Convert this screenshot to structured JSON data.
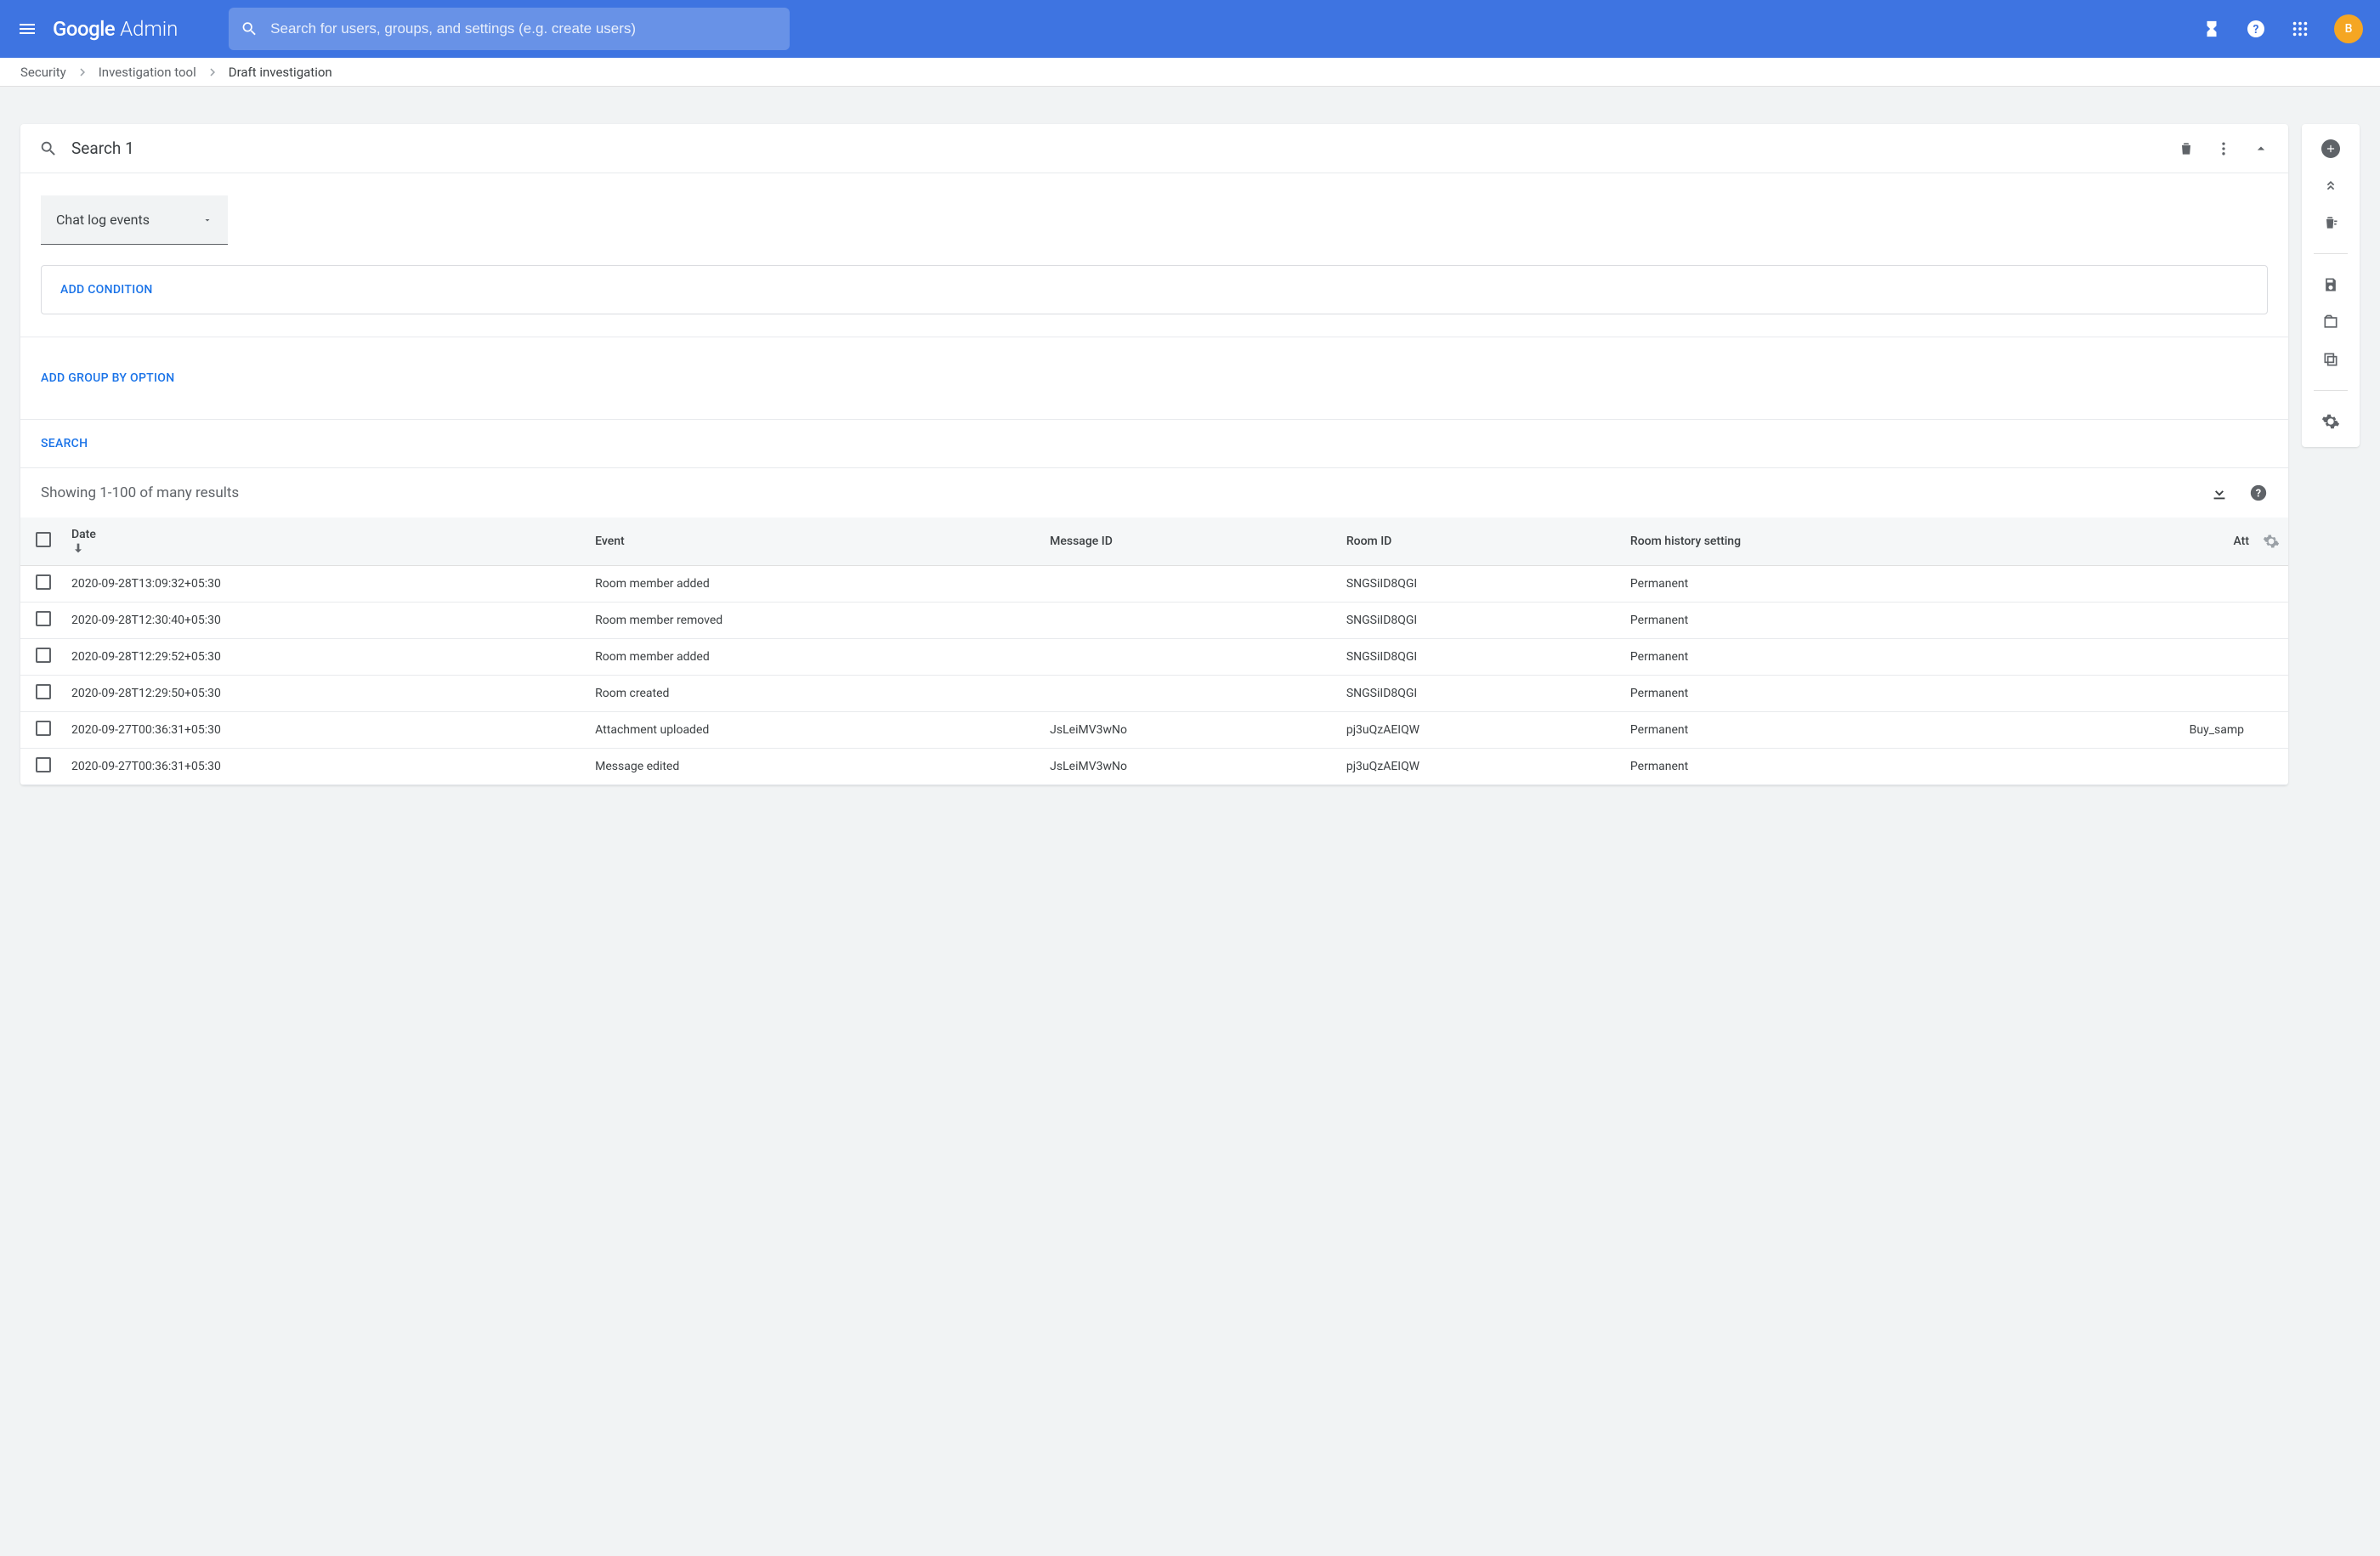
{
  "header": {
    "logo_g": "Google",
    "logo_a": "Admin",
    "search_placeholder": "Search for users, groups, and settings (e.g. create users)",
    "avatar_letter": "B"
  },
  "breadcrumb": {
    "items": [
      "Security",
      "Investigation tool",
      "Draft investigation"
    ]
  },
  "search": {
    "title": "Search 1",
    "data_source": "Chat log events",
    "add_condition": "ADD CONDITION",
    "add_group": "ADD GROUP BY OPTION",
    "search_btn": "SEARCH"
  },
  "results": {
    "summary": "Showing 1-100 of many results",
    "columns": {
      "date": "Date",
      "event": "Event",
      "message_id": "Message ID",
      "room_id": "Room ID",
      "room_history": "Room history setting",
      "att": "Att"
    },
    "rows": [
      {
        "date": "2020-09-28T13:09:32+05:30",
        "event": "Room member added",
        "message_id": "",
        "room_id": "SNGSiID8QGI",
        "room_history": "Permanent",
        "att": ""
      },
      {
        "date": "2020-09-28T12:30:40+05:30",
        "event": "Room member removed",
        "message_id": "",
        "room_id": "SNGSiID8QGI",
        "room_history": "Permanent",
        "att": ""
      },
      {
        "date": "2020-09-28T12:29:52+05:30",
        "event": "Room member added",
        "message_id": "",
        "room_id": "SNGSiID8QGI",
        "room_history": "Permanent",
        "att": ""
      },
      {
        "date": "2020-09-28T12:29:50+05:30",
        "event": "Room created",
        "message_id": "",
        "room_id": "SNGSiID8QGI",
        "room_history": "Permanent",
        "att": ""
      },
      {
        "date": "2020-09-27T00:36:31+05:30",
        "event": "Attachment uploaded",
        "message_id": "JsLeiMV3wNo",
        "room_id": "pj3uQzAEIQW",
        "room_history": "Permanent",
        "att": "Buy_samp"
      },
      {
        "date": "2020-09-27T00:36:31+05:30",
        "event": "Message edited",
        "message_id": "JsLeiMV3wNo",
        "room_id": "pj3uQzAEIQW",
        "room_history": "Permanent",
        "att": ""
      }
    ]
  }
}
